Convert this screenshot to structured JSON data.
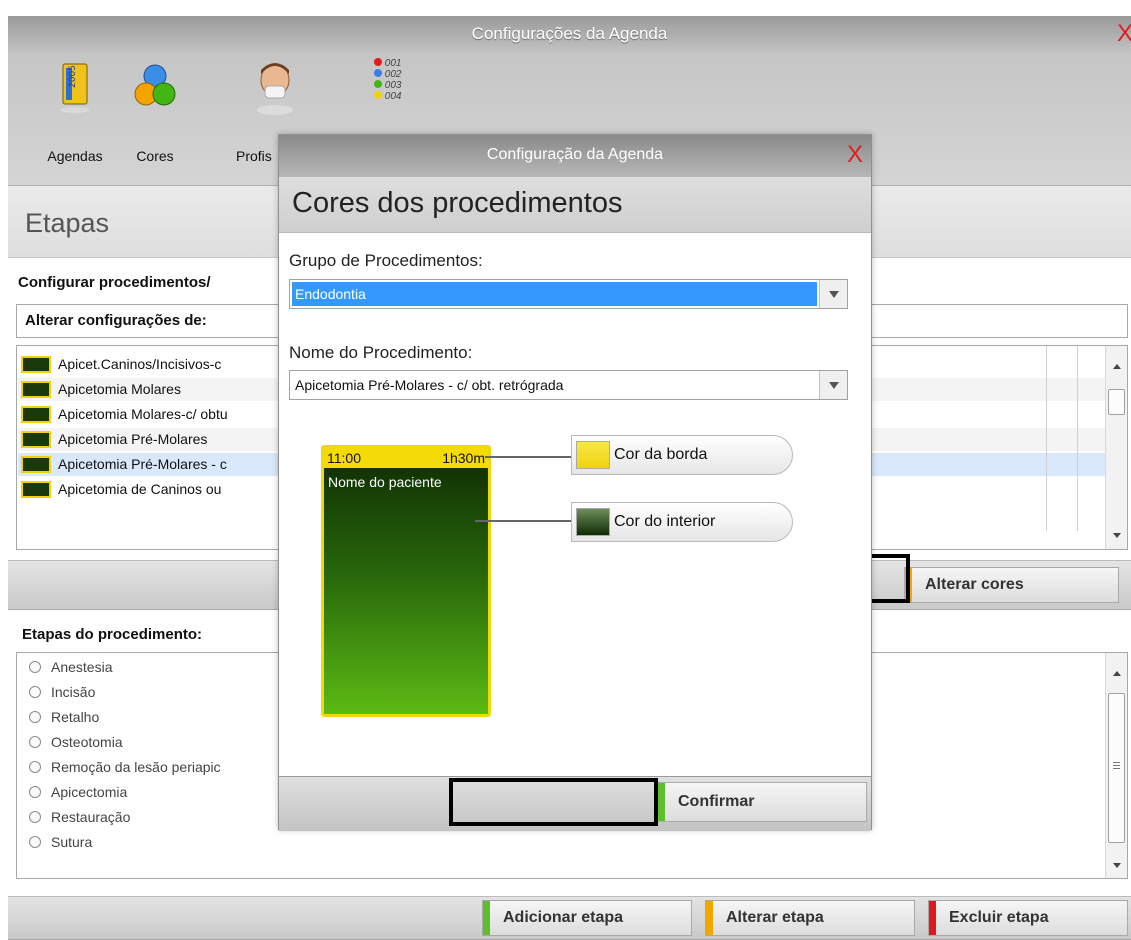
{
  "main_window": {
    "title": "Configurações da Agenda",
    "close_glyph": "X",
    "toolbar": [
      {
        "label": "Agendas",
        "icon": "agenda-2005-book-icon"
      },
      {
        "label": "Cores",
        "icon": "color-circles-icon"
      },
      {
        "label": "Profis",
        "icon": "dentist-professional-icon"
      },
      {
        "label": "",
        "icon": "numbered-priority-list-icon",
        "codes": [
          "001",
          "002",
          "003",
          "004"
        ]
      }
    ],
    "section_title": "Etapas"
  },
  "procedures_section": {
    "label": "Configurar procedimentos/",
    "alter_label": "Alterar configurações de:",
    "items": [
      "Apicet.Caninos/Incisivos-c",
      "Apicetomia Molares",
      "Apicetomia Molares-c/ obtu",
      "Apicetomia Pré-Molares",
      "Apicetomia Pré-Molares - c",
      "Apicetomia de Caninos ou"
    ],
    "alter_colors_button": "Alterar cores"
  },
  "steps_section": {
    "label": "Etapas do procedimento:",
    "items": [
      "Anestesia",
      "Incisão",
      "Retalho",
      "Osteotomia",
      "Remoção da lesão periapic",
      "Apicectomia",
      "Restauração",
      "Sutura"
    ]
  },
  "bottom_bar": {
    "add": "Adicionar etapa",
    "edit": "Alterar etapa",
    "delete": "Excluir etapa"
  },
  "dialog": {
    "title": "Configuração da Agenda",
    "close_glyph": "X",
    "heading": "Cores dos procedimentos",
    "group_label": "Grupo de Procedimentos:",
    "group_value": "Endodontia",
    "name_label": "Nome do Procedimento:",
    "name_value": "Apicetomia Pré-Molares - c/ obt. retrógrada",
    "preview": {
      "time": "11:00",
      "duration": "1h30m",
      "patient": "Nome do paciente"
    },
    "border_color_button": "Cor da borda",
    "interior_color_button": "Cor do interior",
    "confirm_button": "Confirmar"
  },
  "colors": {
    "border_yellow": "#f4db07",
    "interior_dark_green": "#1b3a0c",
    "selected_blue": "#3399ff",
    "close_red": "#e21b1b",
    "accent_orange": "#f0a800",
    "accent_green": "#5fbf2a",
    "accent_red": "#e0191e"
  }
}
